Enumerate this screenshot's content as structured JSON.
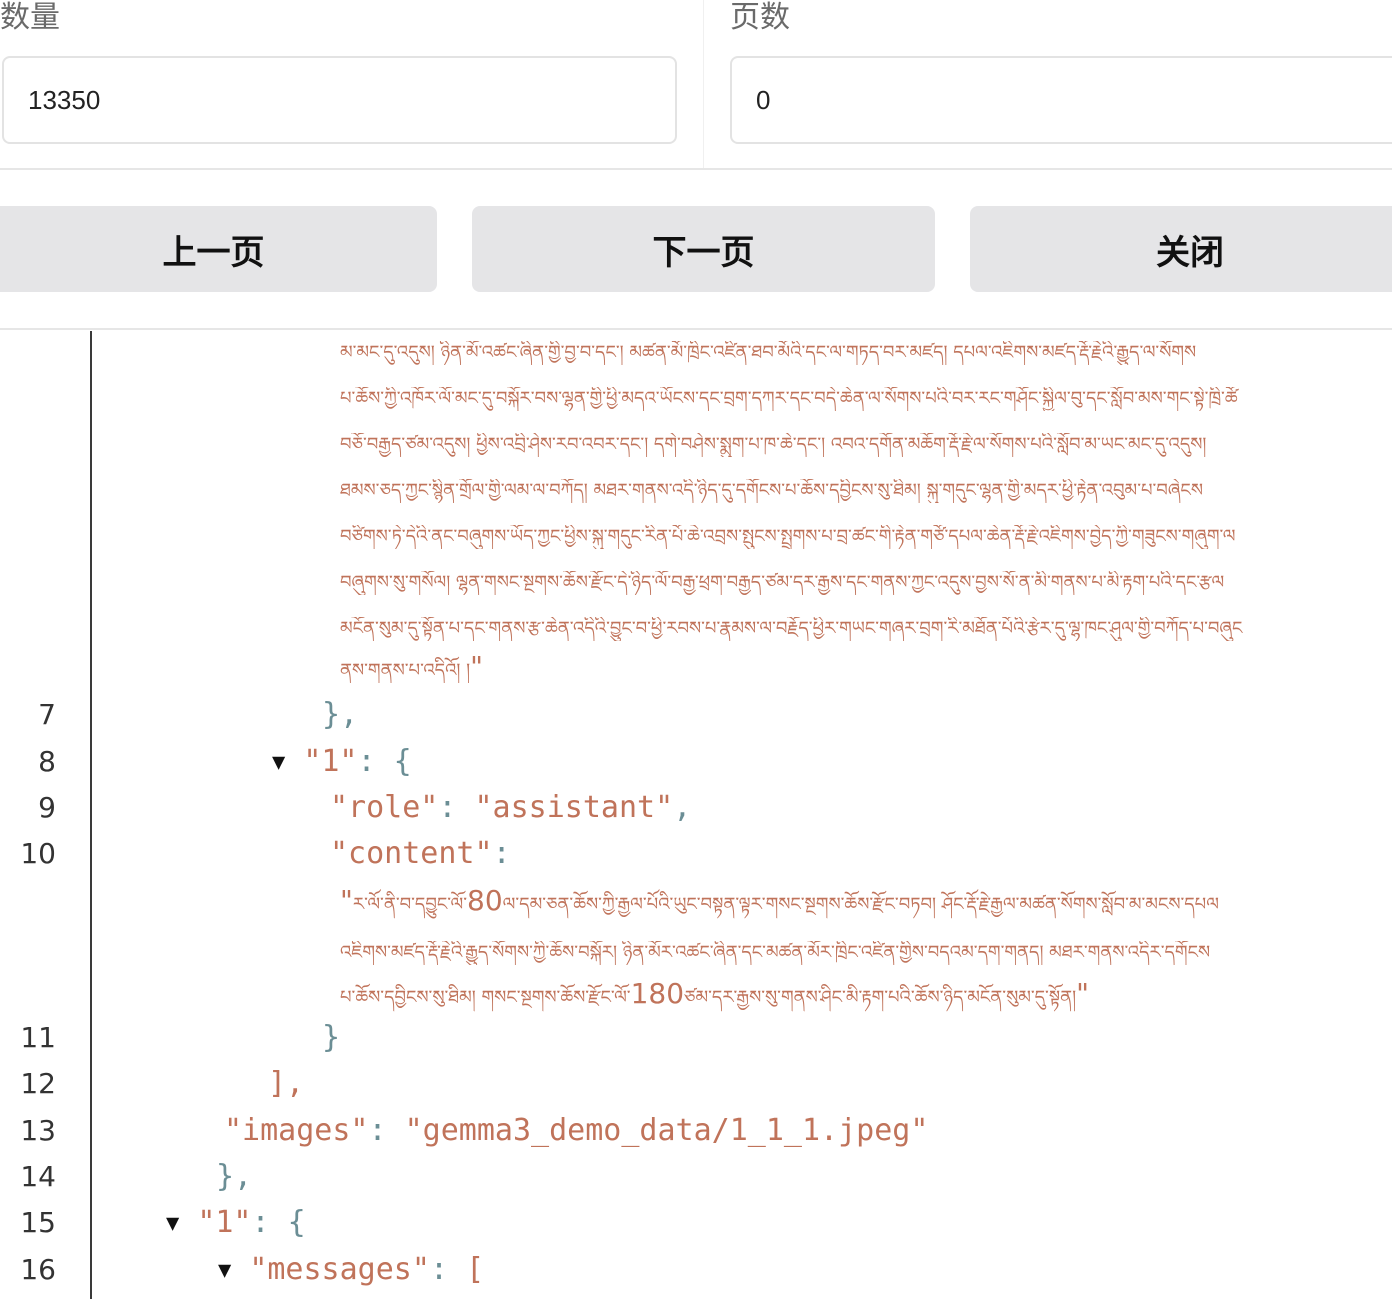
{
  "quantity": {
    "label": "数量",
    "value": "13350"
  },
  "pages": {
    "label": "页数",
    "value": "0"
  },
  "buttons": {
    "prev": "上一页",
    "next": "下一页",
    "close": "关闭"
  },
  "code": {
    "line_numbers": [
      "7",
      "8",
      "9",
      "10",
      "11",
      "12",
      "13",
      "14",
      "15",
      "16"
    ],
    "tibetan_block_1": [
      "མ་མང་དུ་འདུས། ཉིན་མོ་འཚང་ཞིན་གྱི་བྱ་བ་དང་། མཚན་མོ་ཁྲིང་འཛིན་ཐབ་མོའི་དང་ལ་གཏད་བར་མཛད། དཔལ་འཇིགས་མཛད་རྡོ་རྗེའི་རྒྱུད་ལ་སོགས",
      "པ་ཆོས་ཀྱི་འཁོར་ལོ་མང་དུ་བསྐོར་བས་ལྷན་གྱི་ཕྱི་མདའ་ཡོངས་དང་བྲག་དཀར་དང་བདེ་ཆེན་ལ་སོགས་པའི་བར་རང་གཤོང་སྐྱིལ་བུ་དང་སློབ་མས་གང་སྟེ་ཁྲི་ཚོ",
      "བཅོ་བརྒྱད་ཙམ་འདུས། ཕྱིས་འབྲི་ཤེས་རབ་འབར་དང་། དགེ་བཤེས་སྨུག་པ་ཁ་ཆེ་དང་། འབའ་དགོན་མཆོག་རྡོ་རྗེ་ལ་སོགས་པའི་སློབ་མ་ཡང་མང་དུ་འདུས།",
      "ཐམས་ཅད་ཀྱང་སྙིན་གྲོལ་གྱི་ལམ་ལ་བཀོད། མཐར་གནས་འདི་ཉིད་དུ་དགོངས་པ་ཆོས་དབྱིངས་སུ་ཐིམ། སྐུ་གདུང་ལྷན་གྱི་མདར་ཕྱི་རྟེན་འབུམ་པ་བཞེངས",
      "བཙིགས་ཏེ་དེའི་ནང་བཞུགས་ཡོད་ཀྱང་ཕྱིས་སྐུ་གདུང་རིན་པོ་ཆེ་འབྲས་སྤུངས་སྤྲགས་པ་བྲ་ཚང་གི་རྟེན་གཙོ་དཔལ་ཆེན་རྡོ་རྗེ་འཇིགས་བྱེད་ཀྱི་གཟུངས་གཞུག་ལ",
      "བཞུགས་སུ་གསོལ། ལྷན་གསང་སྔགས་ཆོས་རྫོང་དེ་ཉིད་ལོ་བརྒྱ་ཕྲག་བརྒྱད་ཙམ་དར་རྒྱས་དང་གནས་ཀྱང་འདུས་བྱས་སོ་ན་མི་གནས་པ་མི་རྟག་པའི་དང་རྩལ",
      "མངོན་སུམ་དུ་སྟོན་པ་དང་གནས་རྩ་ཆེན་འདིའི་བྱུང་བ་ཕྱི་རབས་པ་རྣམས་ལ་བརྗོད་ཕྱིར་གཡང་གཞར་བྲག་རི་མཐོན་པོའི་རྩེར་དུ་ལྷ་ཁང་ཤུལ་གྱི་བཀོད་པ་བཞུང",
      "ནས་གནས་པ་འདིའོ། །"
    ],
    "tibetan_block_1_closing_quote": "\"",
    "brace_close_comma": "},",
    "key_1": "\"1\"",
    "colon": ":",
    "open_brace": "{",
    "role_key": "\"role\"",
    "role_value": "\"assistant\"",
    "comma": ",",
    "content_key": "\"content\"",
    "quote": "\"",
    "tibetan_block_2": [
      [
        "ར་ལོ་ནི་བ་དབྱུང་ལོ་",
        "80",
        "ལ་དམ་ཅན་ཆོས་ཀྱི་རྒྱལ་པོའི་ཡུང་བསྟན་ལྟར་གསང་སྔགས་ཆོས་རྫོང་བཏབ། ཤོང་རྡོ་རྗེ་རྒྱལ་མཚན་སོགས་སློབ་མ་མངས་དཔལ"
      ],
      [
        "འཇིགས་མཛད་རྡོ་རྗེའི་རྒྱུད་སོགས་ཀྱི་ཆོས་བསྐོར། ཉིན་མོར་འཚང་ཞིན་དང་མཚན་མོར་ཁྲིང་འཛིན་གྱིས་བདའམ་དག་གནད། མཐར་གནས་འདིར་དགོངས",
        "",
        ""
      ],
      [
        "པ་ཆོས་དབྱིངས་སུ་ཐིམ། གསང་སྔགས་ཆོས་རྫོང་ལོ་",
        "180",
        "ཙམ་དར་རྒྱས་སུ་གནས་ཤིང་མི་རྟག་པའི་ཆོས་ཉིད་མངོན་སུམ་དུ་སྟོན།"
      ]
    ],
    "close_brace": "}",
    "close_bracket_comma": "],",
    "images_key": "\"images\"",
    "images_value": "\"gemma3_demo_data/1_1_1.jpeg\"",
    "messages_key": "\"messages\"",
    "open_bracket": "["
  }
}
